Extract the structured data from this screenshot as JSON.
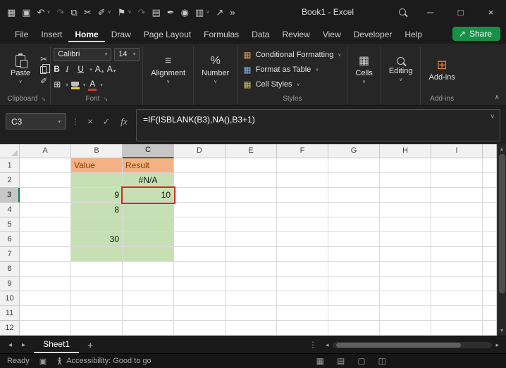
{
  "title_bar": {
    "title": "Book1 - Excel",
    "qat": [
      {
        "name": "app-grid-icon",
        "glyph": "▦"
      },
      {
        "name": "save-icon",
        "glyph": "▣"
      },
      {
        "name": "undo-icon",
        "glyph": "↶",
        "dropdown": true
      },
      {
        "name": "redo-icon",
        "glyph": "↷",
        "disabled": true
      },
      {
        "name": "copy-icon",
        "glyph": "⧉"
      },
      {
        "name": "cut-icon",
        "glyph": "✂"
      },
      {
        "name": "format-painter-icon",
        "glyph": "✐",
        "dropdown": true
      },
      {
        "name": "highlighter-icon",
        "glyph": "⚑",
        "dropdown": true
      },
      {
        "name": "repeat-icon",
        "glyph": "↷",
        "disabled": true
      },
      {
        "name": "new-file-icon",
        "glyph": "▤"
      },
      {
        "name": "ink-pen-icon",
        "glyph": "✒"
      },
      {
        "name": "camera-icon",
        "glyph": "◉"
      },
      {
        "name": "table-tool-icon",
        "glyph": "▥",
        "dropdown": true
      },
      {
        "name": "share-arrow-icon",
        "glyph": "↗"
      },
      {
        "name": "more-commands-icon",
        "glyph": "»"
      }
    ]
  },
  "menu": {
    "share_label": "Share",
    "tabs": [
      {
        "label": "File"
      },
      {
        "label": "Insert"
      },
      {
        "label": "Home",
        "active": true
      },
      {
        "label": "Draw"
      },
      {
        "label": "Page Layout"
      },
      {
        "label": "Formulas"
      },
      {
        "label": "Data"
      },
      {
        "label": "Review"
      },
      {
        "label": "View"
      },
      {
        "label": "Developer"
      },
      {
        "label": "Help"
      }
    ]
  },
  "ribbon": {
    "clipboard": {
      "paste_label": "Paste",
      "label": "Clipboard"
    },
    "font": {
      "family": "Calibri",
      "size": "14",
      "bold": "B",
      "italic": "I",
      "underline": "U",
      "grow": "A",
      "shrink": "A",
      "color_letter": "A",
      "label": "Font"
    },
    "alignment": {
      "label": "Alignment"
    },
    "number": {
      "label": "Number"
    },
    "styles": {
      "items": [
        "Conditional Formatting",
        "Format as Table",
        "Cell Styles"
      ],
      "label": "Styles"
    },
    "cells": {
      "label": "Cells"
    },
    "editing": {
      "label": "Editing"
    },
    "addins": {
      "button_label": "Add-ins",
      "label": "Add-ins"
    }
  },
  "formula_bar": {
    "name_box": "C3",
    "formula": "=IF(ISBLANK(B3),NA(),B3+1)"
  },
  "grid": {
    "columns": [
      "A",
      "B",
      "C",
      "D",
      "E",
      "F",
      "G",
      "H",
      "I"
    ],
    "rows": [
      "1",
      "2",
      "3",
      "4",
      "5",
      "6",
      "7",
      "8",
      "9",
      "10",
      "11",
      "12"
    ],
    "selected_cell": "C3",
    "selected_column": "C",
    "selected_row": "3",
    "cells": [
      {
        "ref": "B1",
        "text": "Value",
        "fill": "orange"
      },
      {
        "ref": "C1",
        "text": "Result",
        "fill": "orange"
      },
      {
        "ref": "B2",
        "text": "",
        "fill": "green"
      },
      {
        "ref": "C2",
        "text": "#N/A",
        "fill": "green",
        "align": "center"
      },
      {
        "ref": "B3",
        "text": "9",
        "fill": "green",
        "align": "right"
      },
      {
        "ref": "C3",
        "text": "10",
        "fill": "green",
        "align": "right",
        "annotated": true
      },
      {
        "ref": "B4",
        "text": "8",
        "fill": "green",
        "align": "right"
      },
      {
        "ref": "C4",
        "text": "",
        "fill": "green"
      },
      {
        "ref": "B5",
        "text": "",
        "fill": "green"
      },
      {
        "ref": "C5",
        "text": "",
        "fill": "green"
      },
      {
        "ref": "B6",
        "text": "30",
        "fill": "green",
        "align": "right"
      },
      {
        "ref": "C6",
        "text": "",
        "fill": "green"
      },
      {
        "ref": "B7",
        "text": "",
        "fill": "green"
      },
      {
        "ref": "C7",
        "text": "",
        "fill": "green"
      }
    ]
  },
  "sheet_bar": {
    "tabs": [
      {
        "label": "Sheet1",
        "active": true
      }
    ]
  },
  "status_bar": {
    "mode": "Ready",
    "accessibility": "Accessibility: Good to go",
    "view_icons": [
      {
        "name": "display-settings-icon",
        "glyph": "▦"
      },
      {
        "name": "normal-view-icon",
        "glyph": "▤"
      },
      {
        "name": "page-layout-view-icon",
        "glyph": "▢"
      },
      {
        "name": "page-break-preview-icon",
        "glyph": "◫"
      }
    ]
  },
  "colors": {
    "accent_green": "#107C41",
    "share_green": "#179148",
    "annotation_red": "#E02518",
    "fill_orange": "#F4B183",
    "fill_orange_text": "#833C00",
    "fill_green": "#C6E0B4"
  },
  "icons": {
    "dropdown": "∨",
    "combo_dropdown": "▾",
    "minimize": "─",
    "maximize": "□",
    "close": "×",
    "share": "↗",
    "cut": "✂",
    "brush": "✐",
    "launcher": "↘",
    "borders": "⊞",
    "align_lines": "≡",
    "percent": "%",
    "cells": "▦",
    "addins": "⊞",
    "formula_cancel": "×",
    "formula_enter": "✓",
    "formula_fx": "fx",
    "separator_dots": "⋮",
    "expand_formula": "∨",
    "collapse_ribbon": "∧",
    "grid_block": "▦",
    "macro": "▣",
    "scroll_up": "▴",
    "scroll_down": "▾",
    "scroll_left": "◂",
    "scroll_right": "▸",
    "add_sheet": "+"
  }
}
